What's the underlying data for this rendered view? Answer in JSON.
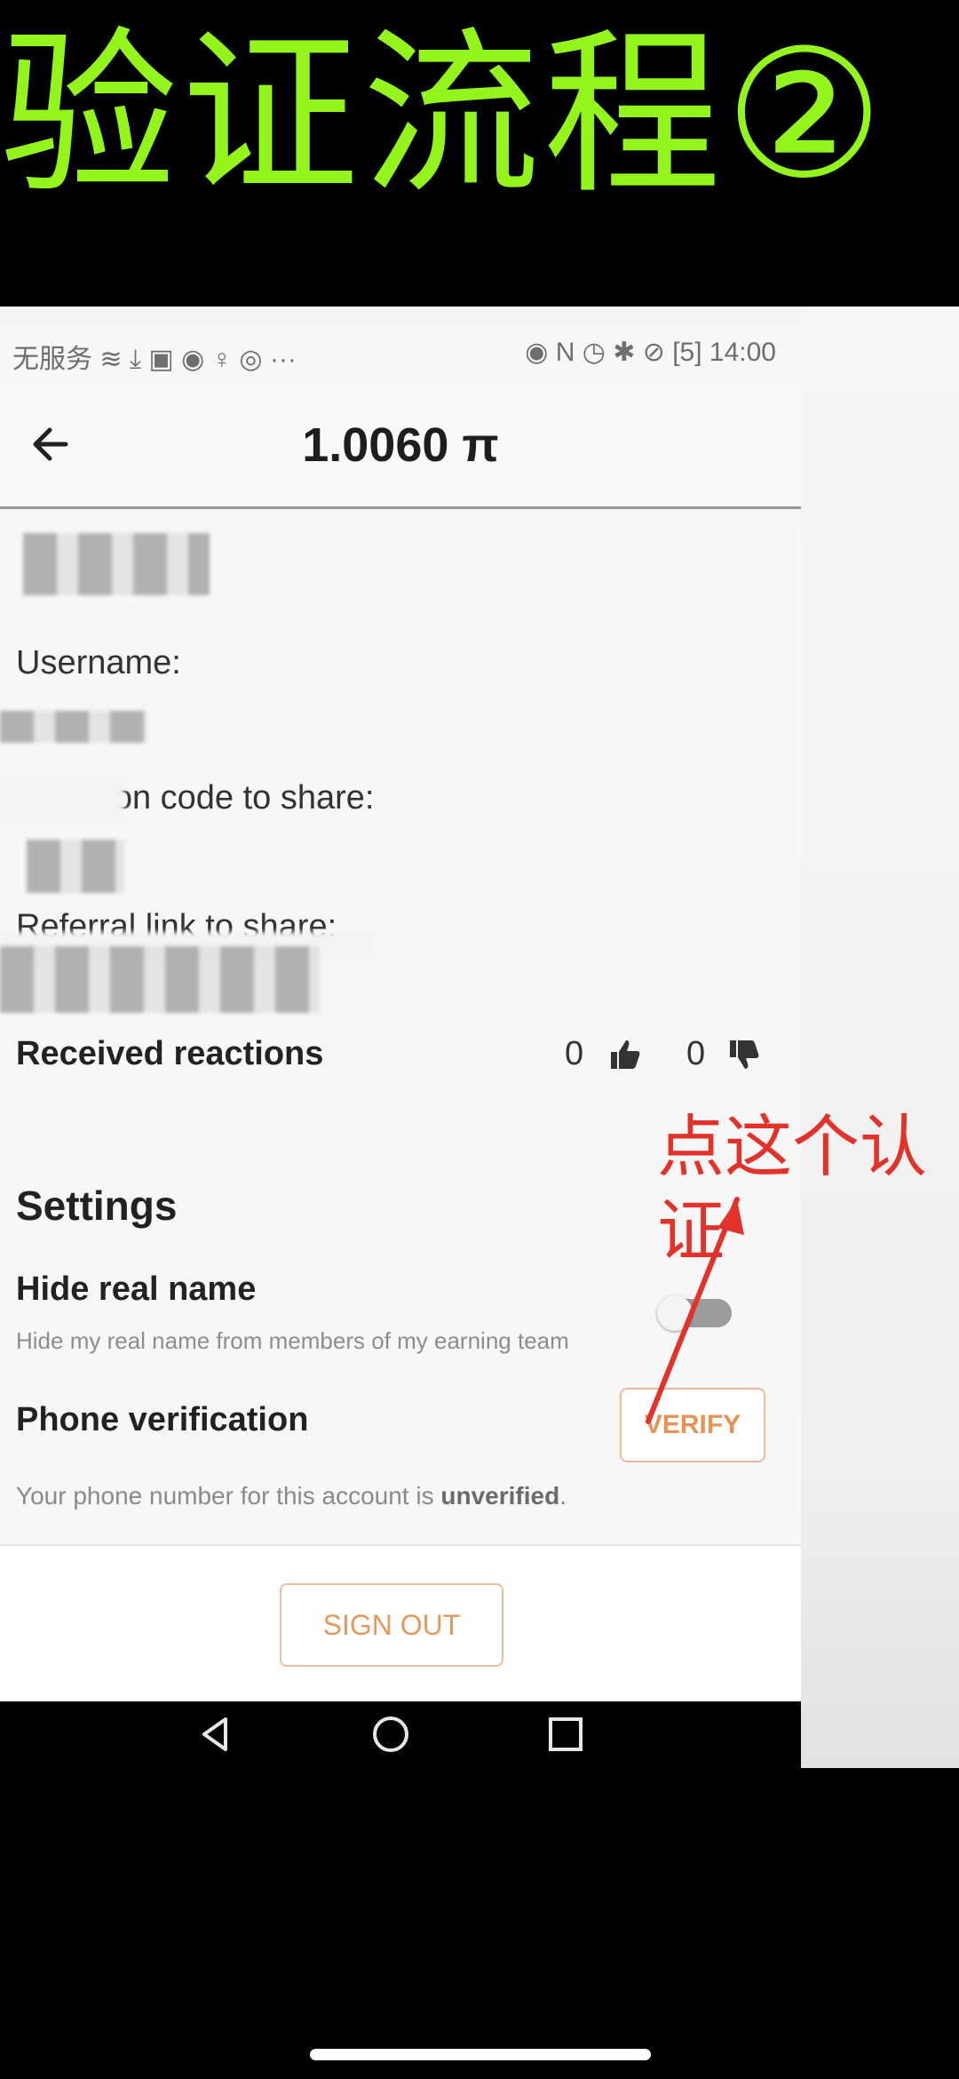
{
  "banner": {
    "title": "验证流程②"
  },
  "status_bar": {
    "left": "无服务",
    "time": "14:00",
    "battery": "5"
  },
  "header": {
    "balance": "1.0060 π",
    "back_icon": "arrow-left-icon"
  },
  "profile": {
    "username_label": "Username:",
    "invitation_label": "Invitation code to share:",
    "referral_label": "Referral link to share:"
  },
  "reactions": {
    "label": "Received reactions",
    "likes": "0",
    "dislikes": "0",
    "like_icon": "thumbs-up-icon",
    "dislike_icon": "thumbs-down-icon"
  },
  "settings": {
    "heading": "Settings",
    "hide_real_name": {
      "title": "Hide real name",
      "description": "Hide my real name from members of my earning team",
      "enabled": false
    },
    "phone_verification": {
      "title": "Phone verification",
      "button_label": "VERIFY",
      "status_prefix": "Your phone number for this account is ",
      "status_value": "unverified",
      "status_suffix": "."
    }
  },
  "footer": {
    "sign_out_label": "SIGN OUT"
  },
  "annotation": {
    "text_line1": "点这个认",
    "text_line2": "证",
    "color": "#e2322a"
  },
  "colors": {
    "banner_text": "#93f51c",
    "accent": "#e59457"
  }
}
